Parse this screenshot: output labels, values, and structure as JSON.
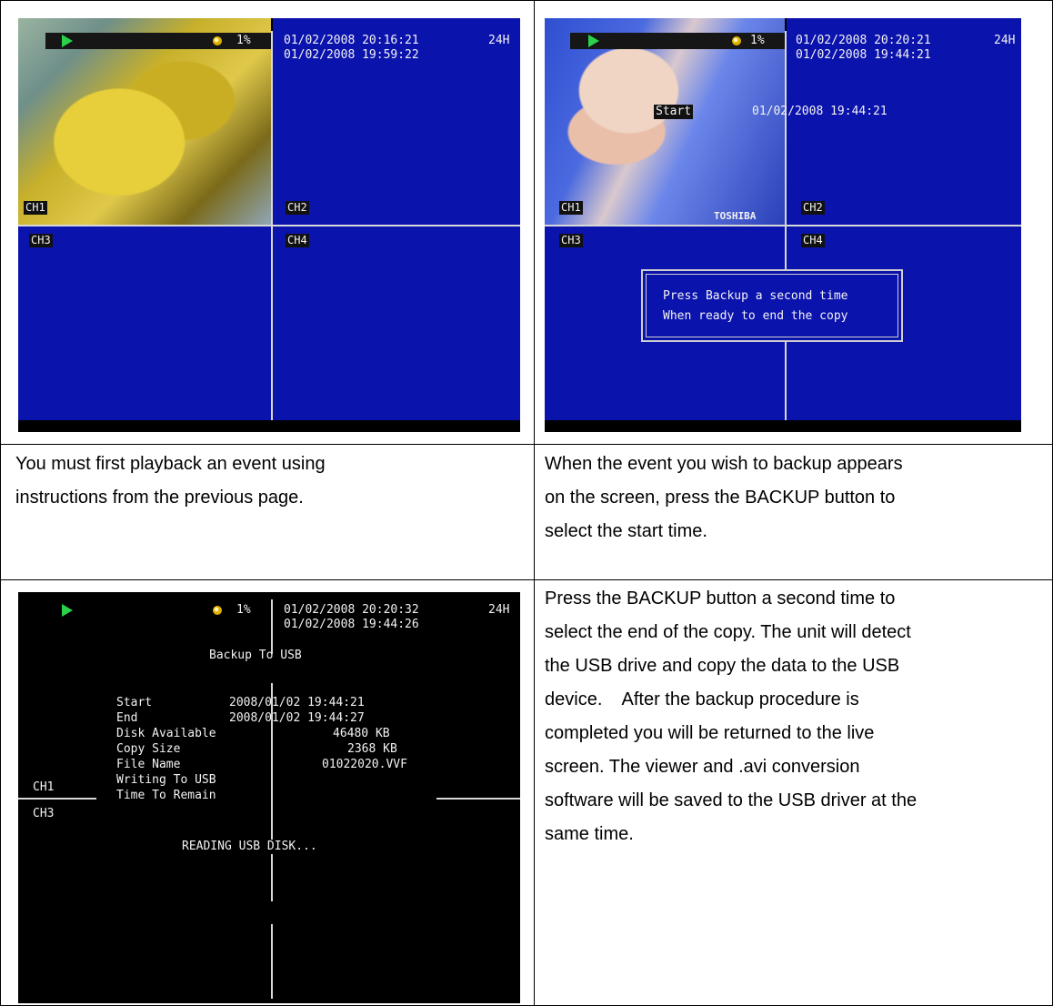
{
  "panel1": {
    "rate": "1%",
    "time_now": "01/02/2008 20:16:21",
    "mode": "24H",
    "time_play": "01/02/2008 19:59:22",
    "ch1": "CH1",
    "ch2": "CH2",
    "ch3": "CH3",
    "ch4": "CH4"
  },
  "panel2": {
    "rate": "1%",
    "time_now": "01/02/2008 20:20:21",
    "mode": "24H",
    "time_play": "01/02/2008 19:44:21",
    "start_label": "Start",
    "start_time": "01/02/2008 19:44:21",
    "brand": "TOSHIBA",
    "message_line1": "Press Backup a second time",
    "message_line2": "When ready to end the copy",
    "ch1": "CH1",
    "ch2": "CH2",
    "ch3": "CH3",
    "ch4": "CH4"
  },
  "panel3": {
    "rate": "1%",
    "time_now": "01/02/2008 20:20:32",
    "mode": "24H",
    "time_play": "01/02/2008 19:44:26",
    "title": "Backup To USB",
    "rows": [
      {
        "label": "Start",
        "value": "2008/01/02 19:44:21"
      },
      {
        "label": "End",
        "value": "2008/01/02 19:44:27"
      },
      {
        "label": "Disk Available",
        "value": "46480 KB"
      },
      {
        "label": "Copy Size",
        "value": "2368 KB"
      },
      {
        "label": "File Name",
        "value": "01022020.VVF"
      },
      {
        "label": "Writing To USB",
        "value": ""
      },
      {
        "label": "Time To Remain",
        "value": ""
      }
    ],
    "status": "READING USB DISK...",
    "ch1": "CH1",
    "ch3": "CH3"
  },
  "captions": {
    "c1_line1": "You must first playback an event using",
    "c1_line2": "instructions from the previous page.",
    "c2_line1": "When the event you wish to backup appears",
    "c2_line2": "on the screen, press the BACKUP button to",
    "c2_line3": "select the start time.",
    "c3_line1": "Press the BACKUP button a second time to",
    "c3_line2": "select the end of the copy. The unit will detect",
    "c3_line3": "the USB drive and copy the data to the USB",
    "c3_line4": "device.    After the backup procedure is",
    "c3_line5": "completed you will be returned to the live",
    "c3_line6": "screen. The viewer and .avi conversion",
    "c3_line7": "software will be saved to the USB driver at the",
    "c3_line8": "same time."
  },
  "colors": {
    "screen_blue": "#0b13ad",
    "play_green": "#2bd14a",
    "border": "#000000"
  }
}
